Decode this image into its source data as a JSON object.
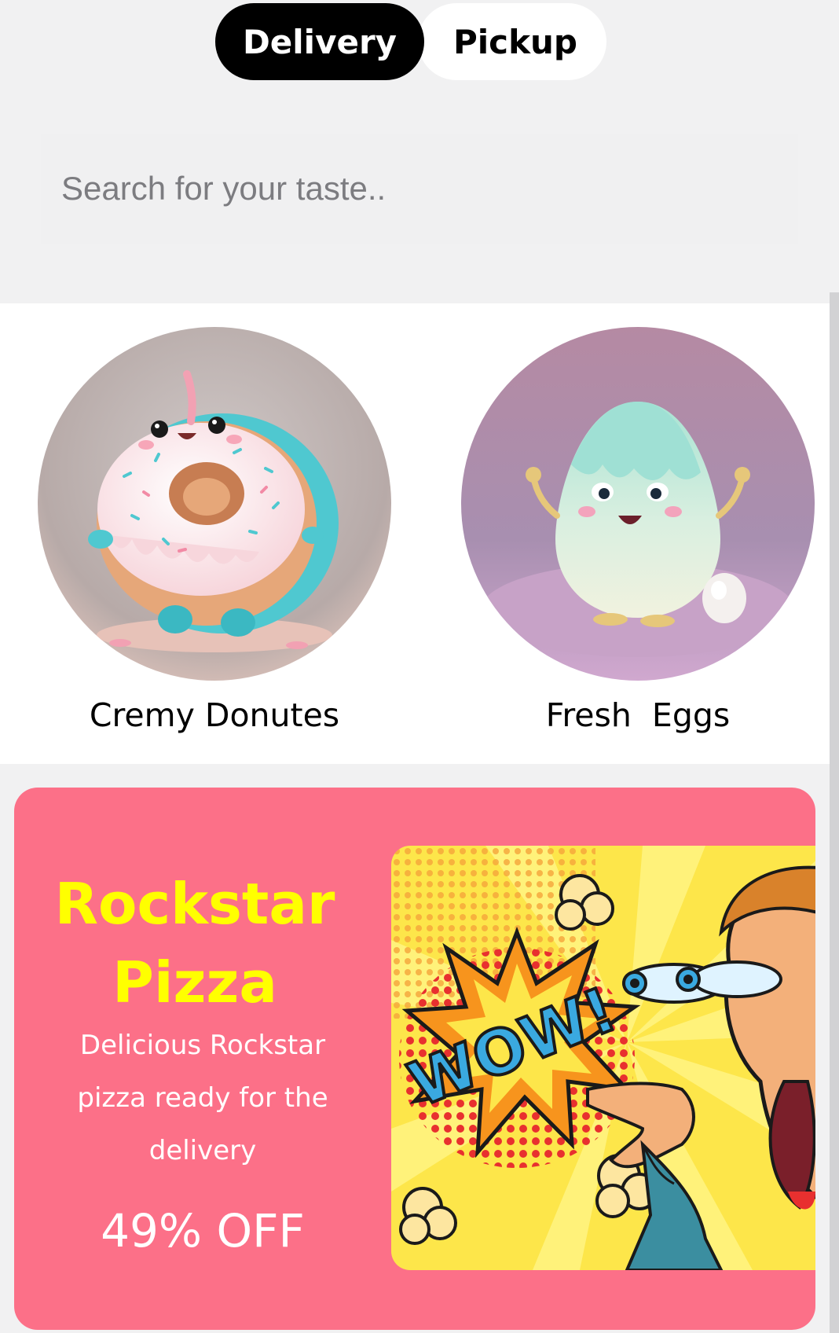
{
  "toggle": {
    "delivery_label": "Delivery",
    "pickup_label": "Pickup",
    "active": "Delivery"
  },
  "search": {
    "placeholder": "Search for your taste.."
  },
  "categories": [
    {
      "label": "Cremy Donutes",
      "icon": "donut-character"
    },
    {
      "label": "Fresh  Eggs",
      "icon": "egg-character"
    }
  ],
  "promo": {
    "title_line1": "Rockstar",
    "title_line2": "Pizza",
    "description": "Delicious Rockstar pizza ready for the delivery",
    "discount": "49% OFF",
    "image_text": "WOW!"
  },
  "colors": {
    "toggle_active_bg": "#000000",
    "page_bg": "#f1f1f2",
    "promo_bg": "#fc7088",
    "promo_title": "#ffff00",
    "promo_text": "#ffffff"
  }
}
